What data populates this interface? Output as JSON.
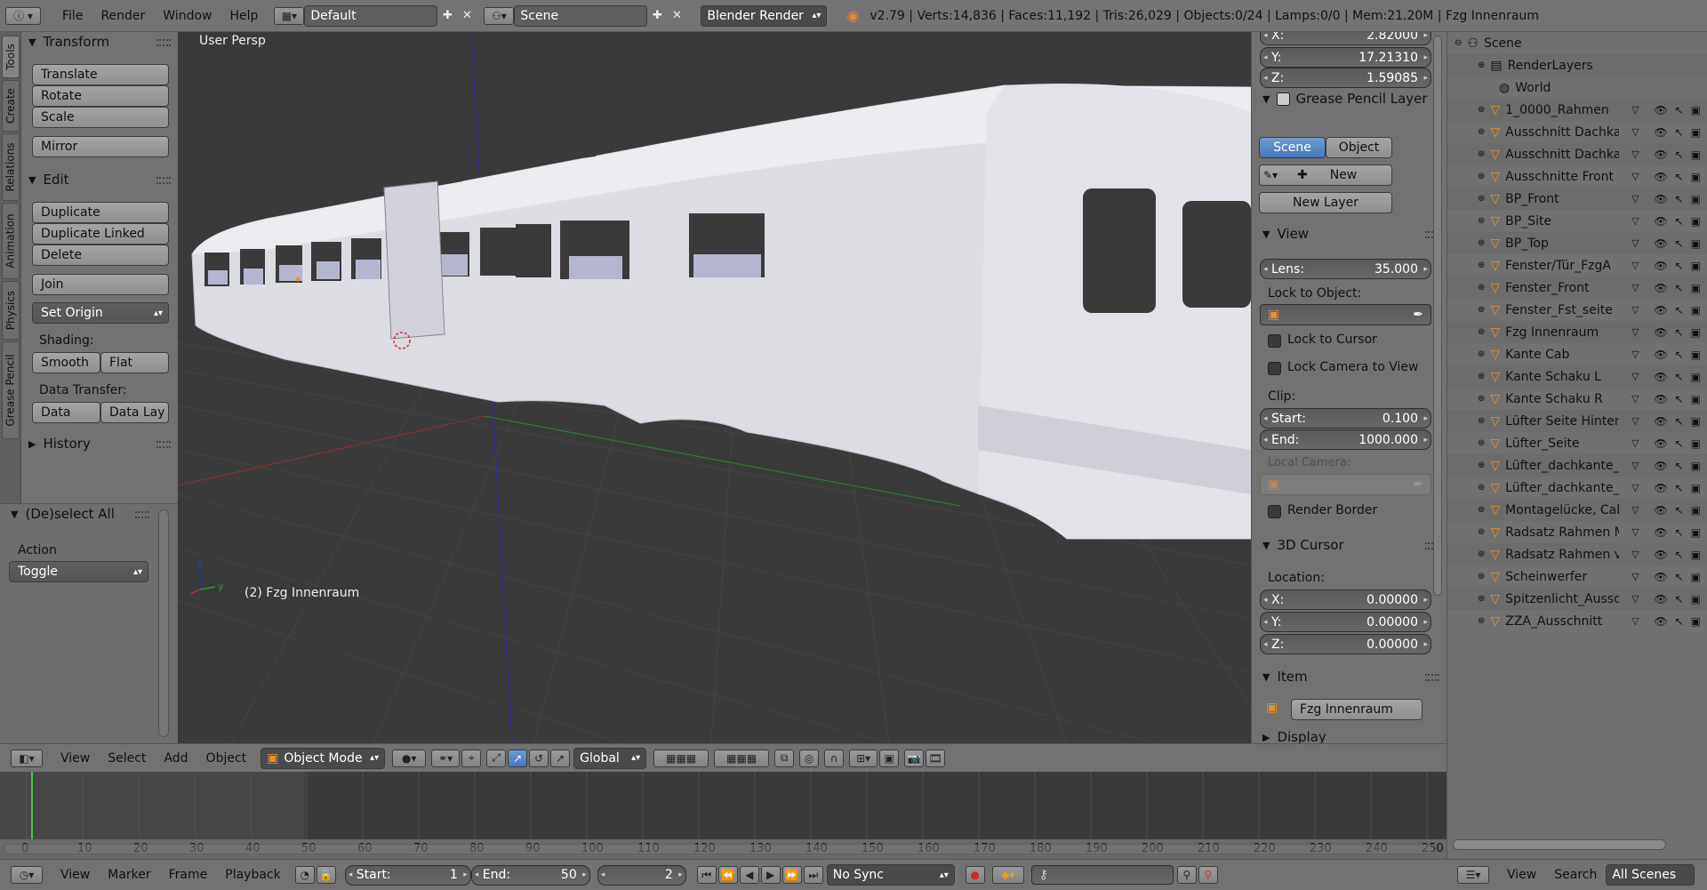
{
  "topbar": {
    "menus": [
      "File",
      "Render",
      "Window",
      "Help"
    ],
    "screen_layout": "Default",
    "scene": "Scene",
    "render_engine": "Blender Render",
    "stats": "v2.79 | Verts:14,836 | Faces:11,192 | Tris:26,029 | Objects:0/24 | Lamps:0/0 | Mem:21.20M | Fzg Innenraum"
  },
  "tabs": [
    "Tools",
    "Create",
    "Relations",
    "Animation",
    "Physics",
    "Grease Pencil"
  ],
  "tools": {
    "transform_title": "Transform",
    "translate": "Translate",
    "rotate": "Rotate",
    "scale": "Scale",
    "mirror": "Mirror",
    "edit_title": "Edit",
    "duplicate": "Duplicate",
    "duplicate_linked": "Duplicate Linked",
    "delete": "Delete",
    "join": "Join",
    "set_origin": "Set Origin",
    "shading_label": "Shading:",
    "smooth": "Smooth",
    "flat": "Flat",
    "data_transfer_label": "Data Transfer:",
    "data": "Data",
    "data_lay": "Data Lay",
    "history_title": "History"
  },
  "operator": {
    "title": "(De)select All",
    "action_label": "Action",
    "action_value": "Toggle"
  },
  "viewport": {
    "persp": "User Persp",
    "object_label": "(2) Fzg Innenraum"
  },
  "props": {
    "loc_x_label": "X:",
    "loc_x": "2.82000",
    "loc_y_label": "Y:",
    "loc_y": "17.21310",
    "loc_z_label": "Z:",
    "loc_z": "1.59085",
    "gp_title": "Grease Pencil Layer",
    "scene_tab": "Scene",
    "object_tab": "Object",
    "new": "New",
    "new_layer": "New Layer",
    "view_title": "View",
    "lens_label": "Lens:",
    "lens": "35.000",
    "lock_obj_label": "Lock to Object:",
    "lock_cursor": "Lock to Cursor",
    "lock_camera": "Lock Camera to View",
    "clip_label": "Clip:",
    "clip_start_label": "Start:",
    "clip_start": "0.100",
    "clip_end_label": "End:",
    "clip_end": "1000.000",
    "local_camera": "Local Camera:",
    "render_border": "Render Border",
    "cursor_title": "3D Cursor",
    "location_label": "Location:",
    "cur_x_label": "X:",
    "cur_x": "0.00000",
    "cur_y_label": "Y:",
    "cur_y": "0.00000",
    "cur_z_label": "Z:",
    "cur_z": "0.00000",
    "item_title": "Item",
    "item_name": "Fzg Innenraum",
    "display_title": "Display"
  },
  "outliner": {
    "scene": "Scene",
    "renderlayers": "RenderLayers",
    "world": "World",
    "objects": [
      "1_0000_Rahmen",
      "Ausschnitt Dachkante",
      "Ausschnitt Dachkante",
      "Ausschnitte Front",
      "BP_Front",
      "BP_Site",
      "BP_Top",
      "Fenster/Tür_FzgA",
      "Fenster_Front",
      "Fenster_Fst_seite",
      "Fzg Innenraum",
      "Kante Cab",
      "Kante Schaku L",
      "Kante Schaku R",
      "Lüfter Seite Hinten",
      "Lüfter_Seite",
      "Lüfter_dachkante_A",
      "Lüfter_dachkante_B",
      "Montagelücke, Cab",
      "Radsatz Rahmen Mitt",
      "Radsatz Rahmen vorn",
      "Scheinwerfer",
      "Spitzenlicht_Ausschni",
      "ZZA_Ausschnitt"
    ],
    "footer": {
      "view": "View",
      "search": "Search",
      "all_scenes": "All Scenes"
    }
  },
  "view3d_header": {
    "view": "View",
    "select": "Select",
    "add": "Add",
    "object": "Object",
    "mode": "Object Mode",
    "orientation": "Global"
  },
  "timeline": {
    "ticks": [
      "0",
      "10",
      "20",
      "30",
      "40",
      "50",
      "60",
      "70",
      "80",
      "90",
      "100",
      "110",
      "120",
      "130",
      "140",
      "150",
      "160",
      "170",
      "180",
      "190",
      "200",
      "210",
      "220",
      "230",
      "240",
      "250"
    ],
    "view": "View",
    "marker": "Marker",
    "frame": "Frame",
    "playback": "Playback",
    "start_label": "Start:",
    "start": "1",
    "end_label": "End:",
    "end": "50",
    "current": "2",
    "sync": "No Sync"
  },
  "colors": {
    "accent_blue": "#5680c2",
    "viewport_bg": "#3a3a3a",
    "panel_bg": "#727272"
  }
}
